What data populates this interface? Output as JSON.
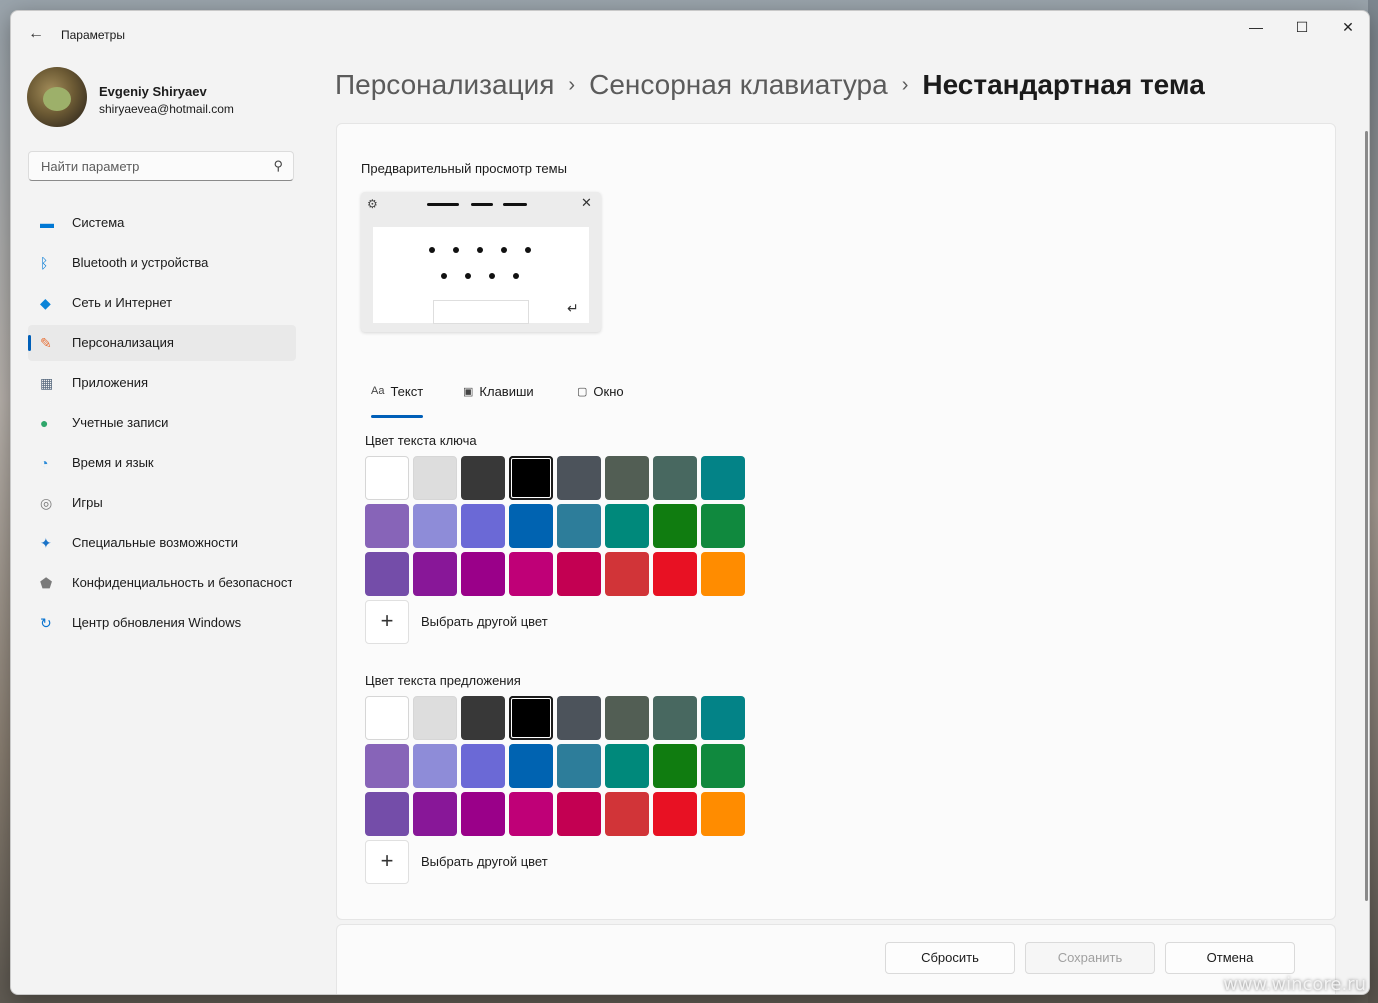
{
  "window": {
    "title": "Параметры",
    "watermark": "www.wincore.ru"
  },
  "titlebar": {
    "back_icon": "arrow-left",
    "minimize": "—",
    "maximize": "☐",
    "close": "✕"
  },
  "profile": {
    "name": "Evgeniy Shiryaev",
    "email": "shiryaevea@hotmail.com"
  },
  "search": {
    "placeholder": "Найти параметр",
    "icon": "search-icon"
  },
  "sidebar": {
    "items": [
      {
        "label": "Система",
        "icon": "system-icon",
        "color": "#0078d4"
      },
      {
        "label": "Bluetooth и устройства",
        "icon": "bluetooth-icon",
        "color": "#0078d4"
      },
      {
        "label": "Сеть и Интернет",
        "icon": "wifi-icon",
        "color": "#0a84d8"
      },
      {
        "label": "Персонализация",
        "icon": "brush-icon",
        "color": "#e8733a",
        "active": true
      },
      {
        "label": "Приложения",
        "icon": "apps-icon",
        "color": "#5a6b80"
      },
      {
        "label": "Учетные записи",
        "icon": "account-icon",
        "color": "#2ea66a"
      },
      {
        "label": "Время и язык",
        "icon": "time-language-icon",
        "color": "#2a8ad8"
      },
      {
        "label": "Игры",
        "icon": "gamepad-icon",
        "color": "#7a7a7a"
      },
      {
        "label": "Специальные возможности",
        "icon": "accessibility-icon",
        "color": "#1a73c8"
      },
      {
        "label": "Конфиденциальность и безопасность",
        "icon": "shield-icon",
        "color": "#7a7a7a"
      },
      {
        "label": "Центр обновления Windows",
        "icon": "update-icon",
        "color": "#0a74d0"
      }
    ]
  },
  "breadcrumb": {
    "first": "Персонализация",
    "second": "Сенсорная клавиатура",
    "current": "Нестандартная тема",
    "separator": "›"
  },
  "preview": {
    "title": "Предварительный просмотр темы"
  },
  "tabs": [
    {
      "label": "Текст",
      "icon": "Aa",
      "active": true
    },
    {
      "label": "Клавиши",
      "icon": "keys-icon"
    },
    {
      "label": "Окно",
      "icon": "window-icon"
    }
  ],
  "key_text": {
    "title": "Цвет текста ключа",
    "selected_index": 3,
    "pick_label": "Выбрать другой цвет"
  },
  "suggestion_text": {
    "title": "Цвет текста предложения",
    "selected_index": 3,
    "pick_label": "Выбрать другой цвет"
  },
  "palette": [
    "#ffffff",
    "#dddddd",
    "#383838",
    "#000000",
    "#4c535b",
    "#525e54",
    "#486860",
    "#038387",
    "#8764b8",
    "#8e8cd8",
    "#6b69d6",
    "#0063b1",
    "#2d7d9a",
    "#00897b",
    "#107c10",
    "#10893e",
    "#744da9",
    "#881798",
    "#9a0089",
    "#bf0077",
    "#c30052",
    "#d13438",
    "#e81123",
    "#ff8c00"
  ],
  "footer": {
    "reset": "Сбросить",
    "save": "Сохранить",
    "cancel": "Отмена"
  },
  "accent": "#005fb8"
}
